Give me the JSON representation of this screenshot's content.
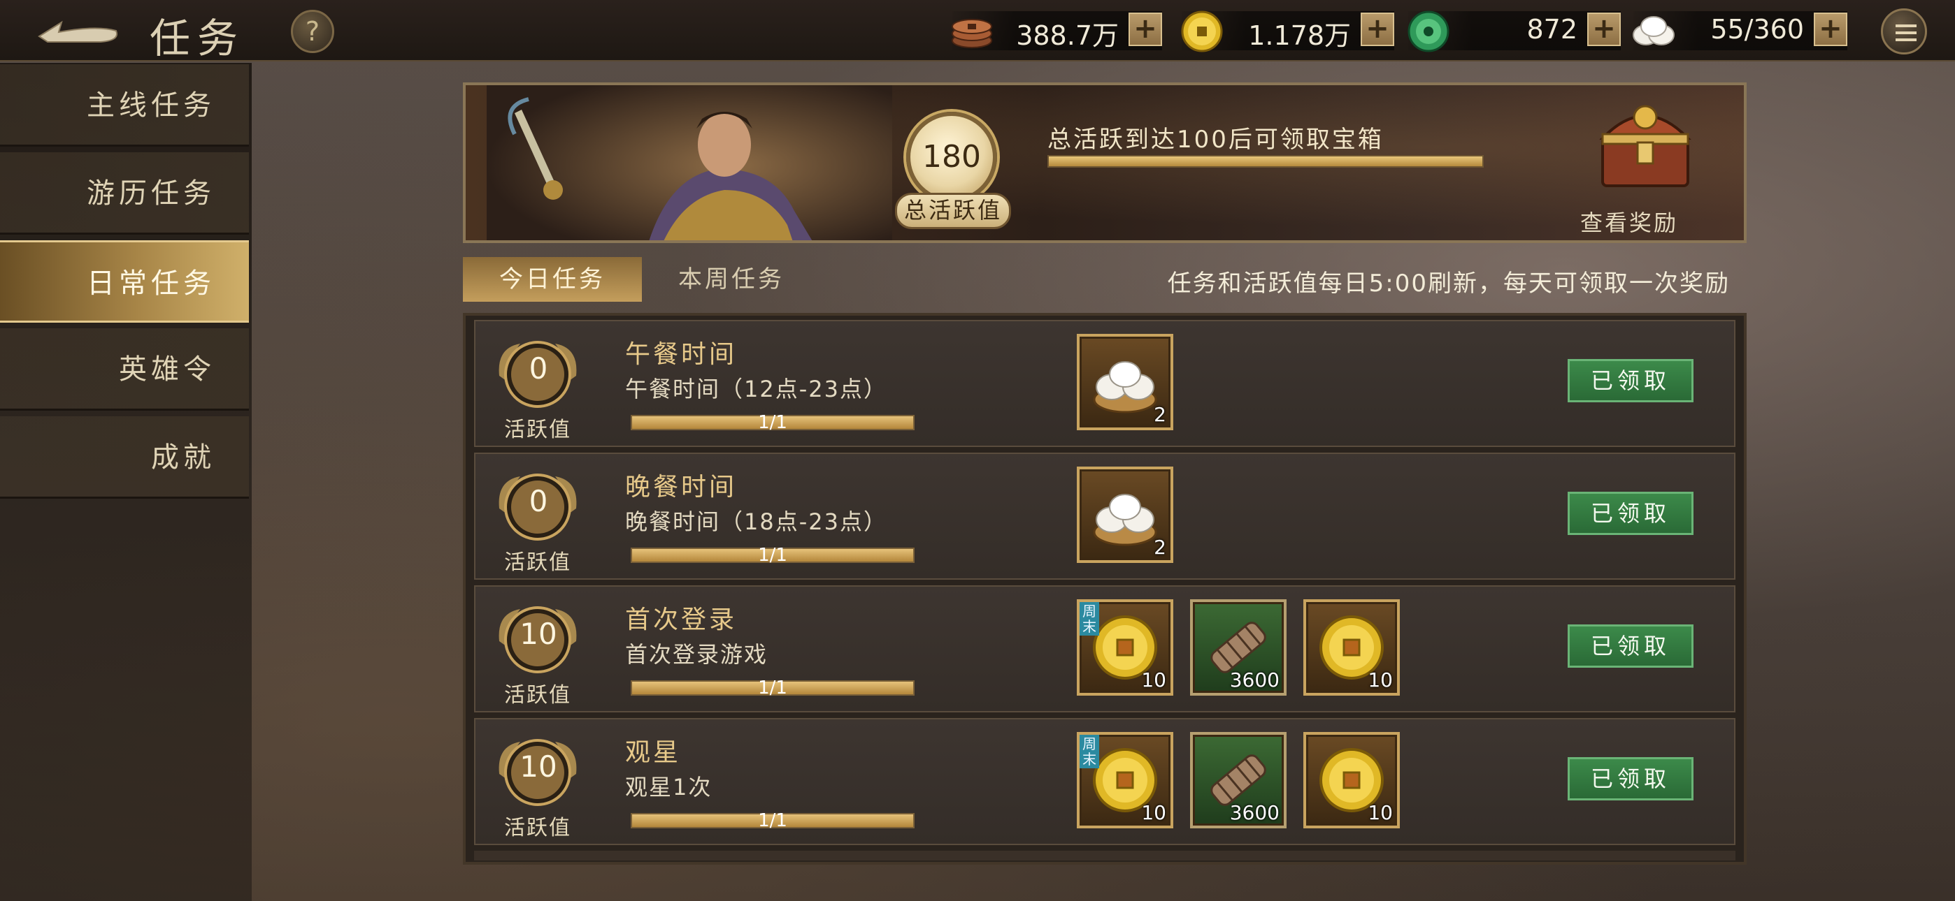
{
  "header": {
    "title": "任务",
    "help_label": "?",
    "resources": [
      {
        "icon": "copper-coins-icon",
        "value": "388.7万"
      },
      {
        "icon": "gold-coin-icon",
        "value": "1.178万"
      },
      {
        "icon": "jade-icon",
        "value": "872"
      },
      {
        "icon": "steamed-bun-icon",
        "value": "55/360"
      }
    ],
    "plus_label": "+"
  },
  "sidebar": {
    "items": [
      {
        "label": "主线任务",
        "active": false
      },
      {
        "label": "游历任务",
        "active": false
      },
      {
        "label": "日常任务",
        "active": true
      },
      {
        "label": "英雄令",
        "active": false
      },
      {
        "label": "成就",
        "active": false
      }
    ]
  },
  "banner": {
    "total_activity_value": "180",
    "total_activity_label": "总活跃值",
    "goal_text": "总活跃到达100后可领取宝箱",
    "progress": 1.0,
    "chest_label": "查看奖励"
  },
  "tabs": {
    "items": [
      {
        "label": "今日任务",
        "active": true
      },
      {
        "label": "本周任务",
        "active": false
      }
    ],
    "notice": "任务和活跃值每日5:00刷新，每天可领取一次奖励"
  },
  "tasks": [
    {
      "activity": "0",
      "activity_label": "活跃值",
      "title": "午餐时间",
      "desc": "午餐时间（12点-23点）",
      "progress_text": "1/1",
      "progress": 1.0,
      "rewards": [
        {
          "icon": "steamed-bun-icon",
          "count": "2",
          "weekly": false
        }
      ],
      "button": "已领取"
    },
    {
      "activity": "0",
      "activity_label": "活跃值",
      "title": "晚餐时间",
      "desc": "晚餐时间（18点-23点）",
      "progress_text": "1/1",
      "progress": 1.0,
      "rewards": [
        {
          "icon": "steamed-bun-icon",
          "count": "2",
          "weekly": false
        }
      ],
      "button": "已领取"
    },
    {
      "activity": "10",
      "activity_label": "活跃值",
      "title": "首次登录",
      "desc": "首次登录游戏",
      "progress_text": "1/1",
      "progress": 1.0,
      "rewards": [
        {
          "icon": "gold-coin-icon",
          "count": "10",
          "weekly": true,
          "weekly_label": "周末"
        },
        {
          "icon": "bamboo-scroll-icon",
          "count": "3600",
          "weekly": false
        },
        {
          "icon": "gold-coin-icon",
          "count": "10",
          "weekly": false
        }
      ],
      "button": "已领取"
    },
    {
      "activity": "10",
      "activity_label": "活跃值",
      "title": "观星",
      "desc": "观星1次",
      "progress_text": "1/1",
      "progress": 1.0,
      "rewards": [
        {
          "icon": "gold-coin-icon",
          "count": "10",
          "weekly": true,
          "weekly_label": "周末"
        },
        {
          "icon": "bamboo-scroll-icon",
          "count": "3600",
          "weekly": false
        },
        {
          "icon": "gold-coin-icon",
          "count": "10",
          "weekly": false
        }
      ],
      "button": "已领取"
    }
  ]
}
